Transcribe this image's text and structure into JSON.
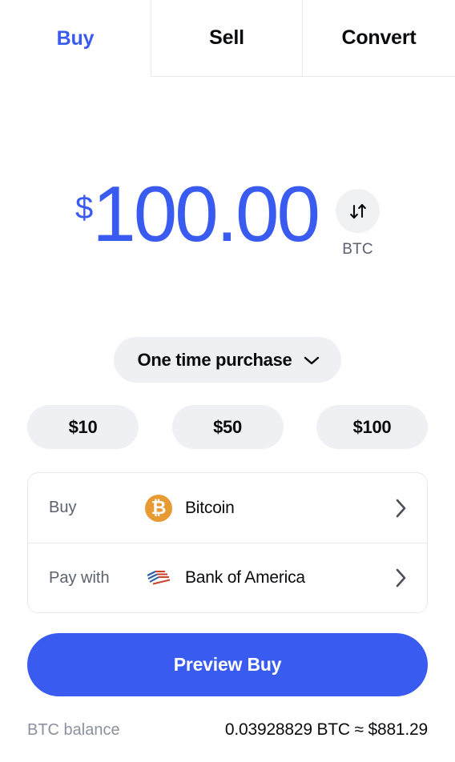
{
  "theme": {
    "accent_blue": "#3A5BF0",
    "pill_gray": "#EFF0F3",
    "border_gray": "#E8E9EB",
    "text_dark": "#0A0B0D",
    "text_muted": "#5B616E",
    "bitcoin_orange": "#E89A33"
  },
  "tabs": [
    {
      "label": "Buy",
      "active": true
    },
    {
      "label": "Sell",
      "active": false
    },
    {
      "label": "Convert",
      "active": false
    }
  ],
  "amount": {
    "currency_symbol": "$",
    "value": "100.00",
    "swap_icon": "swap-vertical-icon",
    "asset_label": "BTC"
  },
  "frequency": {
    "label": "One time purchase",
    "chevron_icon": "chevron-down-icon"
  },
  "quick_amounts": [
    {
      "label": "$10"
    },
    {
      "label": "$50"
    },
    {
      "label": "$100"
    }
  ],
  "details": [
    {
      "key": "Buy",
      "icon": "bitcoin-icon",
      "icon_glyph": "₿",
      "value": "Bitcoin",
      "chevron_icon": "chevron-right-icon"
    },
    {
      "key": "Pay with",
      "icon": "bank-of-america-icon",
      "icon_glyph": "",
      "value": "Bank of America",
      "chevron_icon": "chevron-right-icon"
    }
  ],
  "cta": {
    "label": "Preview Buy"
  },
  "balance": {
    "label": "BTC balance",
    "value": "0.03928829 BTC ≈ $881.29"
  }
}
